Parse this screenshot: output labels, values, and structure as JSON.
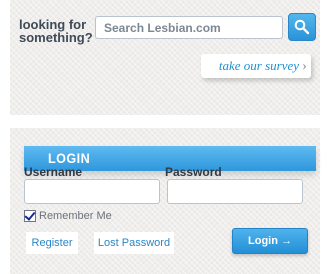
{
  "search": {
    "label": "looking for something?",
    "placeholder": "Search Lesbian.com",
    "survey_link": "take our survey",
    "survey_chevron": "›"
  },
  "login": {
    "title": "LOGIN",
    "username_label": "Username",
    "password_label": "Password",
    "remember_label": "Remember Me",
    "remember_checked": true,
    "register_label": "Register",
    "lost_password_label": "Lost Password",
    "login_button_label": "Login →"
  },
  "colors": {
    "accent": "#2f97dc",
    "link": "#2b86c6"
  }
}
